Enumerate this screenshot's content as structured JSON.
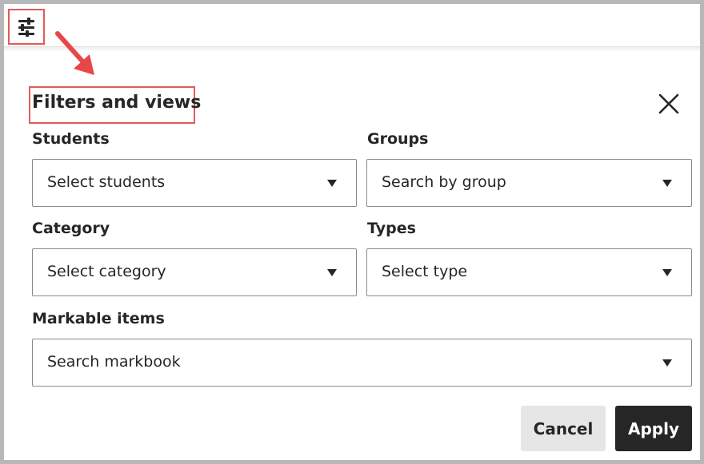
{
  "toolbar": {
    "filter_icon": "sliders-icon"
  },
  "panel": {
    "title": "Filters and views",
    "close_icon": "close-icon"
  },
  "filters": {
    "students": {
      "label": "Students",
      "placeholder": "Select students"
    },
    "groups": {
      "label": "Groups",
      "placeholder": "Search by group"
    },
    "category": {
      "label": "Category",
      "placeholder": "Select category"
    },
    "types": {
      "label": "Types",
      "placeholder": "Select type"
    },
    "markable_items": {
      "label": "Markable items",
      "placeholder": "Search markbook"
    }
  },
  "actions": {
    "cancel_label": "Cancel",
    "apply_label": "Apply"
  },
  "colors": {
    "highlight": "#e25a5a",
    "primary_button": "#262626",
    "secondary_button": "#e6e6e6"
  }
}
